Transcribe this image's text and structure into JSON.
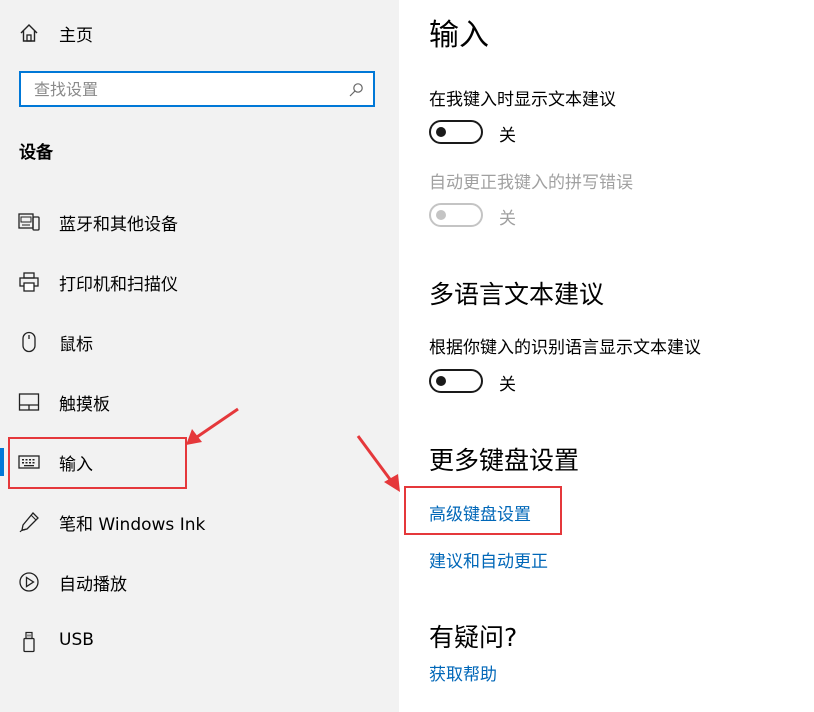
{
  "colors": {
    "accent": "#0078d7",
    "link": "#0067b8",
    "annotation": "#e5383b",
    "sidebar_bg": "#f2f2f2"
  },
  "sidebar": {
    "home": {
      "label": "主页",
      "icon": "home-icon"
    },
    "search": {
      "placeholder": "查找设置",
      "value": "",
      "icon": "search-icon"
    },
    "section_title": "设备",
    "items": [
      {
        "label": "蓝牙和其他设备",
        "icon": "bluetooth-devices-icon",
        "selected": false
      },
      {
        "label": "打印机和扫描仪",
        "icon": "printer-icon",
        "selected": false
      },
      {
        "label": "鼠标",
        "icon": "mouse-icon",
        "selected": false
      },
      {
        "label": "触摸板",
        "icon": "touchpad-icon",
        "selected": false
      },
      {
        "label": "输入",
        "icon": "keyboard-icon",
        "selected": true
      },
      {
        "label": "笔和 Windows Ink",
        "icon": "pen-icon",
        "selected": false
      },
      {
        "label": "自动播放",
        "icon": "autoplay-icon",
        "selected": false
      },
      {
        "label": "USB",
        "icon": "usb-icon",
        "selected": false
      }
    ]
  },
  "main": {
    "title": "输入",
    "settings": [
      {
        "label": "在我键入时显示文本建议",
        "state": "关",
        "on": false,
        "enabled": true
      },
      {
        "label": "自动更正我键入的拼写错误",
        "state": "关",
        "on": false,
        "enabled": false
      }
    ],
    "multilingual": {
      "heading": "多语言文本建议",
      "label": "根据你键入的识别语言显示文本建议",
      "state": "关",
      "on": false
    },
    "more_keyboard": {
      "heading": "更多键盘设置",
      "links": [
        "高级键盘设置",
        "建议和自动更正"
      ]
    },
    "help": {
      "heading": "有疑问?",
      "link": "获取帮助"
    }
  }
}
